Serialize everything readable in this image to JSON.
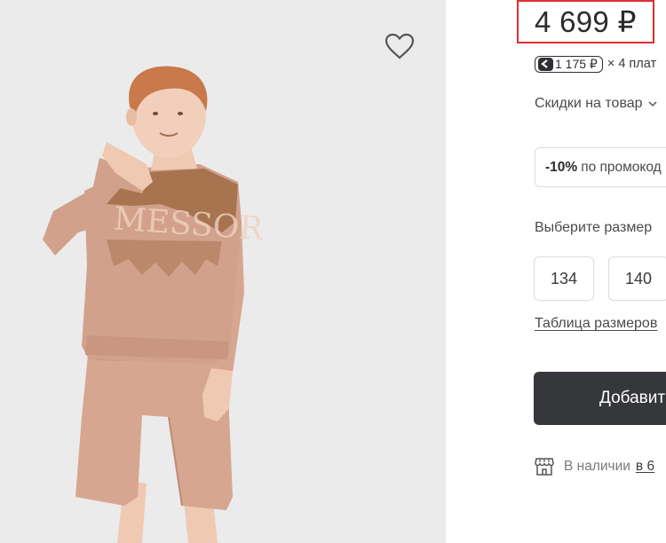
{
  "product": {
    "price": "4 699 ₽",
    "installment": {
      "badge_amount": "1 175 ₽",
      "multiplier_text": "× 4 плат"
    },
    "discounts_label": "Скидки на товар",
    "promo": {
      "percent": "-10%",
      "text": "по промокод"
    },
    "size_section": {
      "label": "Выберите размер",
      "sizes": [
        "134",
        "140"
      ],
      "table_link": "Таблица размеров"
    },
    "add_button_label": "Добавит",
    "stock": {
      "text": "В наличии",
      "link": "в 6"
    }
  },
  "icons": {
    "favorite": "heart-outline-icon",
    "split_logo": "split-logo-icon",
    "discount_toggle": "chevron-down-icon",
    "store": "store-icon"
  },
  "colors": {
    "highlight_border": "#e12e2e",
    "primary_button": "#36373a",
    "photo_background": "#ebebec",
    "garment": "#d2a18b"
  }
}
